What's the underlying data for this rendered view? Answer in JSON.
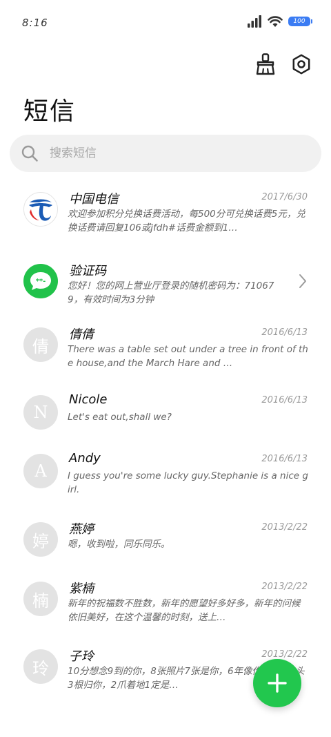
{
  "status_bar": {
    "time": "8:16",
    "battery": "100",
    "signal_icon": "signal-icon",
    "wifi_icon": "wifi-icon"
  },
  "header": {
    "clean_icon": "broom-icon",
    "settings_icon": "settings-icon",
    "title": "短信"
  },
  "search": {
    "placeholder": "搜索短信"
  },
  "messages": [
    {
      "name": "中国电信",
      "date": "2017/6/30",
      "preview": "欢迎参加积分兑换话费活动，每500分可兑换话费5元，兑换话费请回复106或jfdh#话费金额到1…",
      "avatar": "china-telecom-logo"
    },
    {
      "name": "验证码",
      "date": "",
      "preview": "您好！您的网上营业厅登录的随机密码为：710679，有效时间为3分钟",
      "avatar": "verification-code-icon"
    },
    {
      "name": "倩倩",
      "date": "2016/6/13",
      "preview": "There was a table set out under a tree in front of the house,and the March Hare and …",
      "avatar_letter": "倩"
    },
    {
      "name": "Nicole",
      "date": "2016/6/13",
      "preview": "Let's eat out,shall we?",
      "avatar_letter": "N"
    },
    {
      "name": "Andy",
      "date": "2016/6/13",
      "preview": "I guess you're some lucky guy.Stephanie is a nice girl.",
      "avatar_letter": "A"
    },
    {
      "name": "燕婷",
      "date": "2013/2/22",
      "preview": "嗯，收到啦，同乐同乐。",
      "avatar_letter": "婷"
    },
    {
      "name": "紫楠",
      "date": "2013/2/22",
      "preview": "新年的祝福数不胜数，新年的愿望好多好多，新年的问候依旧美好，在这个温馨的时刻，送上…",
      "avatar_letter": "楠"
    },
    {
      "name": "子玲",
      "date": "2013/2/22",
      "preview": "10分想念9到的你，8张照片7张是你，6年像你，4根骨头3根归你，2爪着地1定是…",
      "avatar_letter": "玲"
    }
  ],
  "fab": {
    "icon": "plus-icon"
  },
  "colors": {
    "accent_green": "#22c74e",
    "battery_blue": "#3b7cf3",
    "search_bg": "#f1f1f1",
    "avatar_gray": "#e3e3e3"
  }
}
